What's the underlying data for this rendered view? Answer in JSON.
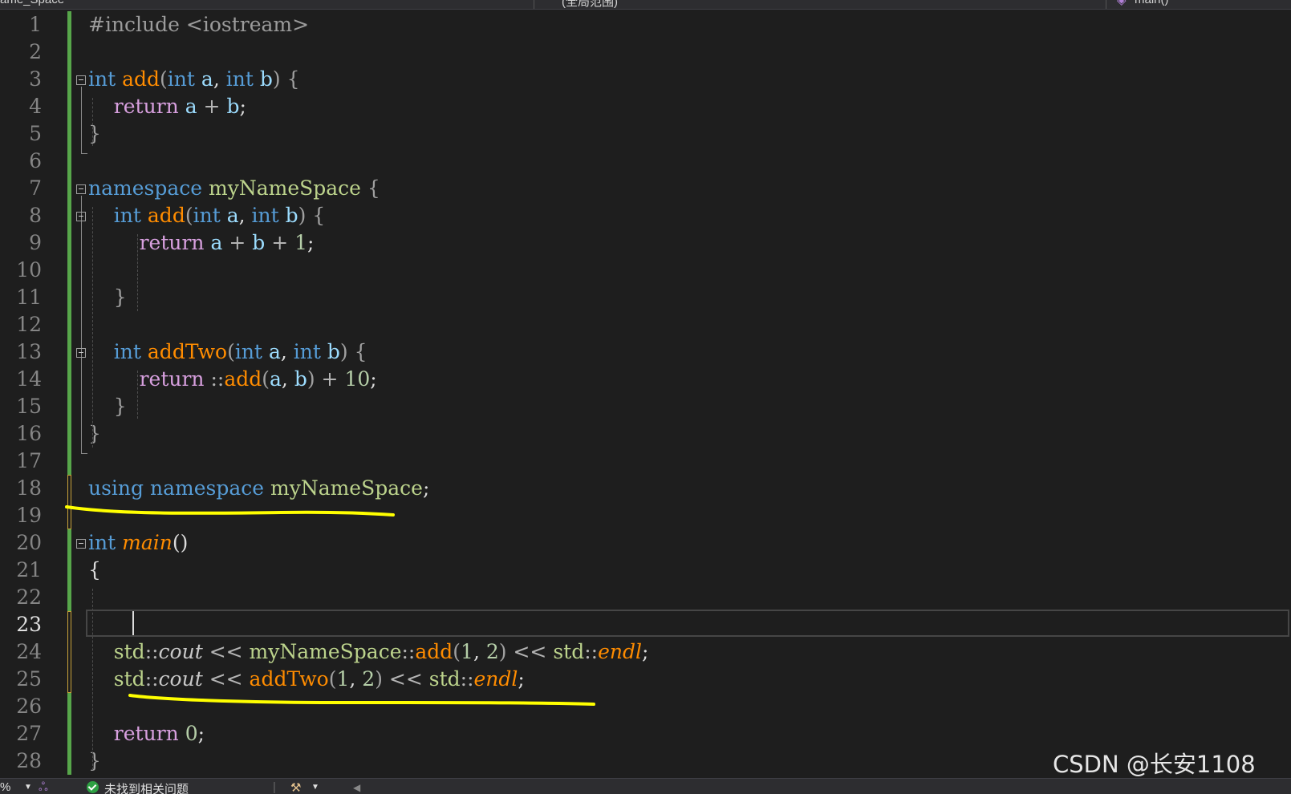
{
  "tabs": {
    "project": "ame_Space",
    "scope": "(全局范围)",
    "member": "main()"
  },
  "lines": [
    [
      {
        "t": "#include <iostream>",
        "c": "pp"
      }
    ],
    [],
    [
      {
        "t": "int",
        "c": "kw"
      },
      {
        "t": " "
      },
      {
        "t": "add",
        "c": "fn"
      },
      {
        "t": "(",
        "c": "brk"
      },
      {
        "t": "int",
        "c": "kw"
      },
      {
        "t": " "
      },
      {
        "t": "a",
        "c": "par"
      },
      {
        "t": ", "
      },
      {
        "t": "int",
        "c": "kw"
      },
      {
        "t": " "
      },
      {
        "t": "b",
        "c": "par"
      },
      {
        "t": ")",
        "c": "brk"
      },
      {
        "t": " "
      },
      {
        "t": "{",
        "c": "brk"
      }
    ],
    [
      {
        "t": "    "
      },
      {
        "t": "return",
        "c": "ctl"
      },
      {
        "t": " "
      },
      {
        "t": "a",
        "c": "par"
      },
      {
        "t": " + ",
        "c": "op"
      },
      {
        "t": "b",
        "c": "par"
      },
      {
        "t": ";"
      }
    ],
    [
      {
        "t": "}",
        "c": "brk"
      }
    ],
    [],
    [
      {
        "t": "namespace",
        "c": "kw"
      },
      {
        "t": " "
      },
      {
        "t": "myNameSpace",
        "c": "nsg"
      },
      {
        "t": " "
      },
      {
        "t": "{",
        "c": "brk"
      }
    ],
    [
      {
        "t": "    "
      },
      {
        "t": "int",
        "c": "kw"
      },
      {
        "t": " "
      },
      {
        "t": "add",
        "c": "fn"
      },
      {
        "t": "(",
        "c": "brk"
      },
      {
        "t": "int",
        "c": "kw"
      },
      {
        "t": " "
      },
      {
        "t": "a",
        "c": "par"
      },
      {
        "t": ", "
      },
      {
        "t": "int",
        "c": "kw"
      },
      {
        "t": " "
      },
      {
        "t": "b",
        "c": "par"
      },
      {
        "t": ")",
        "c": "brk"
      },
      {
        "t": " "
      },
      {
        "t": "{",
        "c": "brk"
      }
    ],
    [
      {
        "t": "        "
      },
      {
        "t": "return",
        "c": "ctl"
      },
      {
        "t": " "
      },
      {
        "t": "a",
        "c": "par"
      },
      {
        "t": " + ",
        "c": "op"
      },
      {
        "t": "b",
        "c": "par"
      },
      {
        "t": " + ",
        "c": "op"
      },
      {
        "t": "1",
        "c": "num"
      },
      {
        "t": ";"
      }
    ],
    [],
    [
      {
        "t": "    "
      },
      {
        "t": "}",
        "c": "brk"
      }
    ],
    [],
    [
      {
        "t": "    "
      },
      {
        "t": "int",
        "c": "kw"
      },
      {
        "t": " "
      },
      {
        "t": "addTwo",
        "c": "fn"
      },
      {
        "t": "(",
        "c": "brk"
      },
      {
        "t": "int",
        "c": "kw"
      },
      {
        "t": " "
      },
      {
        "t": "a",
        "c": "par"
      },
      {
        "t": ", "
      },
      {
        "t": "int",
        "c": "kw"
      },
      {
        "t": " "
      },
      {
        "t": "b",
        "c": "par"
      },
      {
        "t": ")",
        "c": "brk"
      },
      {
        "t": " "
      },
      {
        "t": "{",
        "c": "brk"
      }
    ],
    [
      {
        "t": "        "
      },
      {
        "t": "return",
        "c": "ctl"
      },
      {
        "t": " ::",
        "c": "op"
      },
      {
        "t": "add",
        "c": "fn"
      },
      {
        "t": "(",
        "c": "brk"
      },
      {
        "t": "a",
        "c": "par"
      },
      {
        "t": ", "
      },
      {
        "t": "b",
        "c": "par"
      },
      {
        "t": ")",
        "c": "brk"
      },
      {
        "t": " + ",
        "c": "op"
      },
      {
        "t": "10",
        "c": "num"
      },
      {
        "t": ";"
      }
    ],
    [
      {
        "t": "    "
      },
      {
        "t": "}",
        "c": "brk"
      }
    ],
    [
      {
        "t": "}",
        "c": "brk"
      }
    ],
    [],
    [
      {
        "t": "using",
        "c": "kw"
      },
      {
        "t": " "
      },
      {
        "t": "namespace",
        "c": "kw"
      },
      {
        "t": " "
      },
      {
        "t": "myNameSpace",
        "c": "nsg"
      },
      {
        "t": ";"
      }
    ],
    [],
    [
      {
        "t": "int",
        "c": "kw"
      },
      {
        "t": " "
      },
      {
        "t": "main",
        "c": "fni"
      },
      {
        "t": "()"
      }
    ],
    [
      {
        "t": "{"
      }
    ],
    [],
    [],
    [
      {
        "t": "    "
      },
      {
        "t": "std",
        "c": "nsg"
      },
      {
        "t": "::",
        "c": "op"
      },
      {
        "t": "cout",
        "c": "std"
      },
      {
        "t": " << ",
        "c": "op"
      },
      {
        "t": "myNameSpace",
        "c": "nsg"
      },
      {
        "t": "::",
        "c": "op"
      },
      {
        "t": "add",
        "c": "fn"
      },
      {
        "t": "(",
        "c": "brk"
      },
      {
        "t": "1",
        "c": "num"
      },
      {
        "t": ", "
      },
      {
        "t": "2",
        "c": "num"
      },
      {
        "t": ")",
        "c": "brk"
      },
      {
        "t": " << ",
        "c": "op"
      },
      {
        "t": "std",
        "c": "nsg"
      },
      {
        "t": "::",
        "c": "op"
      },
      {
        "t": "endl",
        "c": "fni"
      },
      {
        "t": ";"
      }
    ],
    [
      {
        "t": "    "
      },
      {
        "t": "std",
        "c": "nsg"
      },
      {
        "t": "::",
        "c": "op"
      },
      {
        "t": "cout",
        "c": "std"
      },
      {
        "t": " << ",
        "c": "op"
      },
      {
        "t": "addTwo",
        "c": "fn"
      },
      {
        "t": "(",
        "c": "brk"
      },
      {
        "t": "1",
        "c": "num"
      },
      {
        "t": ", "
      },
      {
        "t": "2",
        "c": "num"
      },
      {
        "t": ")",
        "c": "brk"
      },
      {
        "t": " << ",
        "c": "op"
      },
      {
        "t": "std",
        "c": "nsg"
      },
      {
        "t": "::",
        "c": "op"
      },
      {
        "t": "endl",
        "c": "fni"
      },
      {
        "t": ";"
      }
    ],
    [],
    [
      {
        "t": "    "
      },
      {
        "t": "return",
        "c": "ctl"
      },
      {
        "t": " "
      },
      {
        "t": "0",
        "c": "num"
      },
      {
        "t": ";"
      }
    ],
    [
      {
        "t": "}",
        "c": "brk"
      }
    ]
  ],
  "line_numbers": [
    "1",
    "2",
    "3",
    "4",
    "5",
    "6",
    "7",
    "8",
    "9",
    "10",
    "11",
    "12",
    "13",
    "14",
    "15",
    "16",
    "17",
    "18",
    "19",
    "20",
    "21",
    "22",
    "23",
    "24",
    "25",
    "26",
    "27",
    "28"
  ],
  "current_line": 23,
  "status": {
    "zoom": "%",
    "issues_text": "未找到相关问题"
  },
  "watermark": "CSDN @长安1108",
  "colors": {
    "keyword": "#569cd6",
    "control": "#d8a0df",
    "function": "#ff8c00",
    "number": "#b5cea8",
    "namespace": "#bcd38c",
    "annotation": "#ffff00",
    "change_saved": "#57a64a",
    "change_unsaved": "#c8a23a"
  }
}
